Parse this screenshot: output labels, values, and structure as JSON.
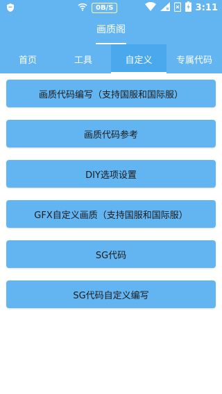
{
  "status_bar": {
    "net_speed": "0B/S",
    "time": "3:11",
    "icons": [
      "shield-icon",
      "wifi-icon",
      "signal-icon",
      "no-sim-icon",
      "battery-icon"
    ]
  },
  "app": {
    "title": "画质阁",
    "accent_color": "#63b5f2",
    "tab_active_color": "#4aa8ed"
  },
  "tabs": [
    {
      "label": "首页",
      "active": false
    },
    {
      "label": "工具",
      "active": false
    },
    {
      "label": "自定义",
      "active": true
    },
    {
      "label": "专属代码",
      "active": false
    }
  ],
  "menu_items": [
    {
      "label": "画质代码编写（支持国服和国际服）"
    },
    {
      "label": "画质代码参考"
    },
    {
      "label": "DIY选项设置"
    },
    {
      "label": "GFX自定义画质（支持国服和国际服）"
    },
    {
      "label": "SG代码"
    },
    {
      "label": "SG代码自定义编写"
    }
  ]
}
